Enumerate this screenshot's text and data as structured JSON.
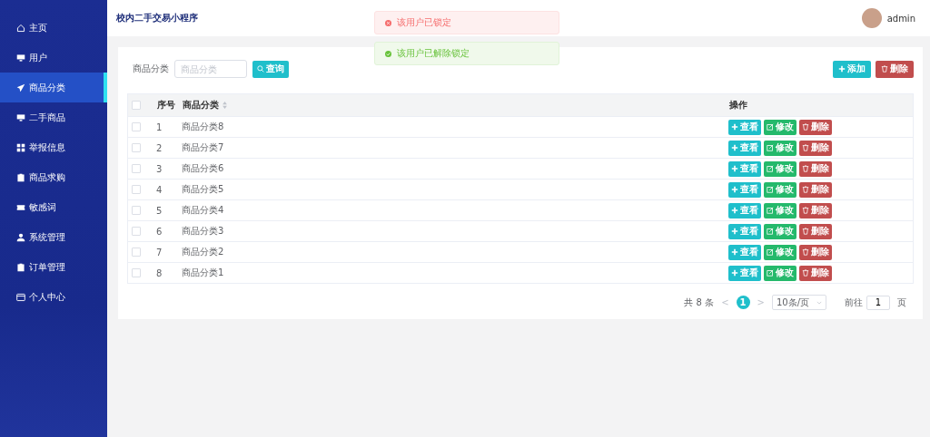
{
  "sidebar": {
    "items": [
      {
        "label": "主页",
        "selected": false
      },
      {
        "label": "用户",
        "selected": false
      },
      {
        "label": "商品分类",
        "selected": true
      },
      {
        "label": "二手商品",
        "selected": false
      },
      {
        "label": "举报信息",
        "selected": false
      },
      {
        "label": "商品求购",
        "selected": false
      },
      {
        "label": "敏感词",
        "selected": false
      },
      {
        "label": "系统管理",
        "selected": false
      },
      {
        "label": "订单管理",
        "selected": false
      },
      {
        "label": "个人中心",
        "selected": false
      }
    ]
  },
  "header": {
    "title": "校内二手交易小程序",
    "user": "admin"
  },
  "toasts": [
    {
      "kind": "error",
      "text": "该用户已锁定"
    },
    {
      "kind": "success",
      "text": "该用户已解除锁定"
    }
  ],
  "search": {
    "label": "商品分类",
    "placeholder": "商品分类",
    "button": "查询"
  },
  "actions": {
    "add": "添加",
    "delete": "删除"
  },
  "table": {
    "all_checked": false,
    "columns": [
      "序号",
      "商品分类",
      "操作"
    ],
    "rows": [
      {
        "index": "1",
        "name": "商品分类8",
        "checked": false,
        "buttons": [
          "查看",
          "修改",
          "删除"
        ]
      },
      {
        "index": "2",
        "name": "商品分类7",
        "checked": false,
        "buttons": [
          "查看",
          "修改",
          "删除"
        ]
      },
      {
        "index": "3",
        "name": "商品分类6",
        "checked": false,
        "buttons": [
          "查看",
          "修改",
          "删除"
        ]
      },
      {
        "index": "4",
        "name": "商品分类5",
        "checked": false,
        "buttons": [
          "查看",
          "修改",
          "删除"
        ]
      },
      {
        "index": "5",
        "name": "商品分类4",
        "checked": false,
        "buttons": [
          "查看",
          "修改",
          "删除"
        ]
      },
      {
        "index": "6",
        "name": "商品分类3",
        "checked": false,
        "buttons": [
          "查看",
          "修改",
          "删除"
        ]
      },
      {
        "index": "7",
        "name": "商品分类2",
        "checked": false,
        "buttons": [
          "查看",
          "修改",
          "删除"
        ]
      },
      {
        "index": "8",
        "name": "商品分类1",
        "checked": false,
        "buttons": [
          "查看",
          "修改",
          "删除"
        ]
      }
    ]
  },
  "pagination": {
    "total": "共 8 条",
    "prev": "<",
    "pages": [
      {
        "label": "1",
        "selected": true
      }
    ],
    "next": ">",
    "page_size": "10条/页",
    "goto_label": "前往",
    "goto_value": "1",
    "page_unit": "页"
  }
}
